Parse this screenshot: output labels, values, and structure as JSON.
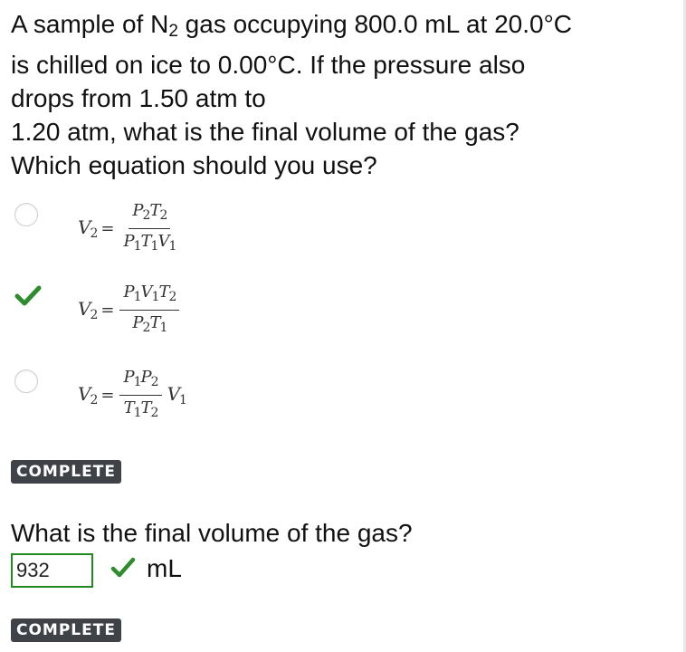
{
  "question1": {
    "lines": [
      {
        "pre": "A sample of N",
        "sub": "2",
        "post": " gas occupying 800.0 mL at 20.0°C"
      },
      {
        "text": "is chilled on ice to 0.00°C. If the pressure also"
      },
      {
        "text": "drops from 1.50 atm to"
      },
      {
        "text": "1.20 atm, what is the final volume of the gas?"
      },
      {
        "text": "Which equation should you use?"
      }
    ]
  },
  "options": [
    {
      "state": "unselected",
      "lhs": "V",
      "lhs_sub": "2",
      "equals": "=",
      "num": [
        {
          "t": "P",
          "s": "2"
        },
        {
          "t": "T",
          "s": "2"
        }
      ],
      "den": [
        {
          "t": "P",
          "s": "1"
        },
        {
          "t": "T",
          "s": "1"
        },
        {
          "t": "V",
          "s": "1"
        }
      ],
      "post": ""
    },
    {
      "state": "correct",
      "lhs": "V",
      "lhs_sub": "2",
      "equals": "=",
      "num": [
        {
          "t": "P",
          "s": "1"
        },
        {
          "t": "V",
          "s": "1"
        },
        {
          "t": "T",
          "s": "2"
        }
      ],
      "den": [
        {
          "t": "P",
          "s": "2"
        },
        {
          "t": "T",
          "s": "1"
        }
      ],
      "post": ""
    },
    {
      "state": "unselected",
      "lhs": "V",
      "lhs_sub": "2",
      "equals": "=",
      "num": [
        {
          "t": "P",
          "s": "1"
        },
        {
          "t": "P",
          "s": "2"
        }
      ],
      "den": [
        {
          "t": "T",
          "s": "1"
        },
        {
          "t": "T",
          "s": "2"
        }
      ],
      "post": {
        "t": "V",
        "s": "1"
      }
    }
  ],
  "badge1": "COMPLETE",
  "question2": {
    "text": "What is the final volume of the gas?",
    "answer_value": "932",
    "unit": "mL"
  },
  "badge2": "COMPLETE",
  "colors": {
    "correct_green": "#2e8b2e",
    "badge_bg": "#3f4247"
  }
}
